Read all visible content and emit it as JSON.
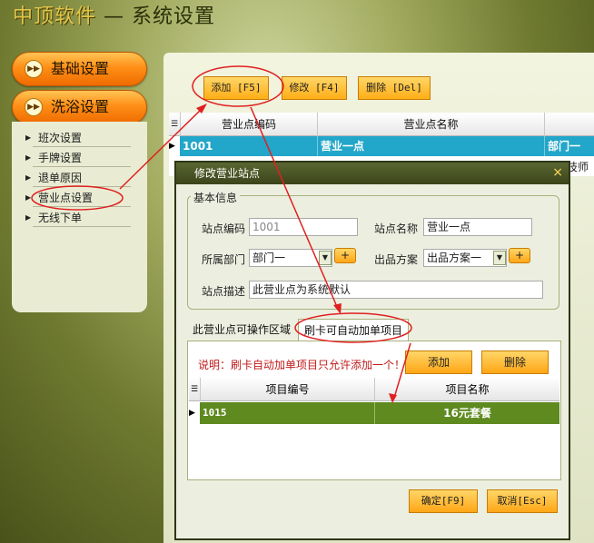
{
  "app": {
    "brand": "中顶软件",
    "title_sep": " — ",
    "page": "系统设置"
  },
  "sidebar": {
    "groups": [
      {
        "label": "基础设置"
      },
      {
        "label": "洗浴设置"
      }
    ],
    "items": [
      {
        "label": "班次设置"
      },
      {
        "label": "手牌设置"
      },
      {
        "label": "退单原因"
      },
      {
        "label": "营业点设置"
      },
      {
        "label": "无线下单"
      }
    ]
  },
  "toolbar": {
    "add": "添加 [F5]",
    "edit": "修改 [F4]",
    "delete": "删除 [Del]"
  },
  "grid": {
    "columns": [
      "营业点编码",
      "营业点名称"
    ],
    "rows": [
      {
        "code": "1001",
        "name": "营业一点",
        "dept": "部门一"
      }
    ],
    "partial_text": "技师"
  },
  "dialog": {
    "title": "修改营业站点",
    "close": "×",
    "basic_legend": "基本信息",
    "fields": {
      "code_label": "站点编码",
      "code_value": "1001",
      "name_label": "站点名称",
      "name_value": "营业一点",
      "dept_label": "所属部门",
      "dept_value": "部门一",
      "plan_label": "出品方案",
      "plan_value": "出品方案一",
      "desc_label": "站点描述",
      "desc_value": "此营业点为系统默认"
    },
    "plus": "+",
    "tabs": [
      "此营业点可操作区域",
      "刷卡可自动加单项目"
    ],
    "note": "说明：刷卡自动加单项目只允许添加一个！",
    "add_btn": "添加",
    "del_btn": "删除",
    "sub_columns": [
      "项目编号",
      "项目名称"
    ],
    "sub_rows": [
      {
        "code": "1015",
        "name": "16元套餐"
      }
    ],
    "ok": "确定[F9]",
    "cancel": "取消[Esc]"
  },
  "colors": {
    "accent_orange": "#ff9a1e",
    "selected_row_blue": "#22a6c9",
    "selected_row_green": "#5e8a1f",
    "annotation_red": "#e02020"
  }
}
